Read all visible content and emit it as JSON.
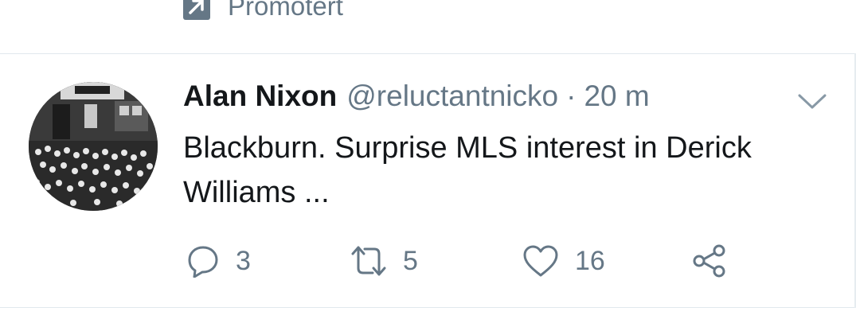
{
  "promoted": {
    "label": "Promotert",
    "icon": "promoted-arrow-icon"
  },
  "tweet": {
    "avatar": "avatar",
    "author_name": "Alan Nixon",
    "handle": "@reluctantnicko",
    "separator": "·",
    "time": "20 m",
    "text": "Blackburn. Surprise MLS interest in Derick Williams ...",
    "menu_icon": "chevron-down-icon"
  },
  "actions": {
    "reply": {
      "icon": "reply-icon",
      "count": "3"
    },
    "retweet": {
      "icon": "retweet-icon",
      "count": "5"
    },
    "like": {
      "icon": "heart-icon",
      "count": "16"
    },
    "share": {
      "icon": "share-icon"
    }
  },
  "colors": {
    "text_primary": "#14171a",
    "text_secondary": "#657786",
    "divider": "#e1e8ed"
  }
}
